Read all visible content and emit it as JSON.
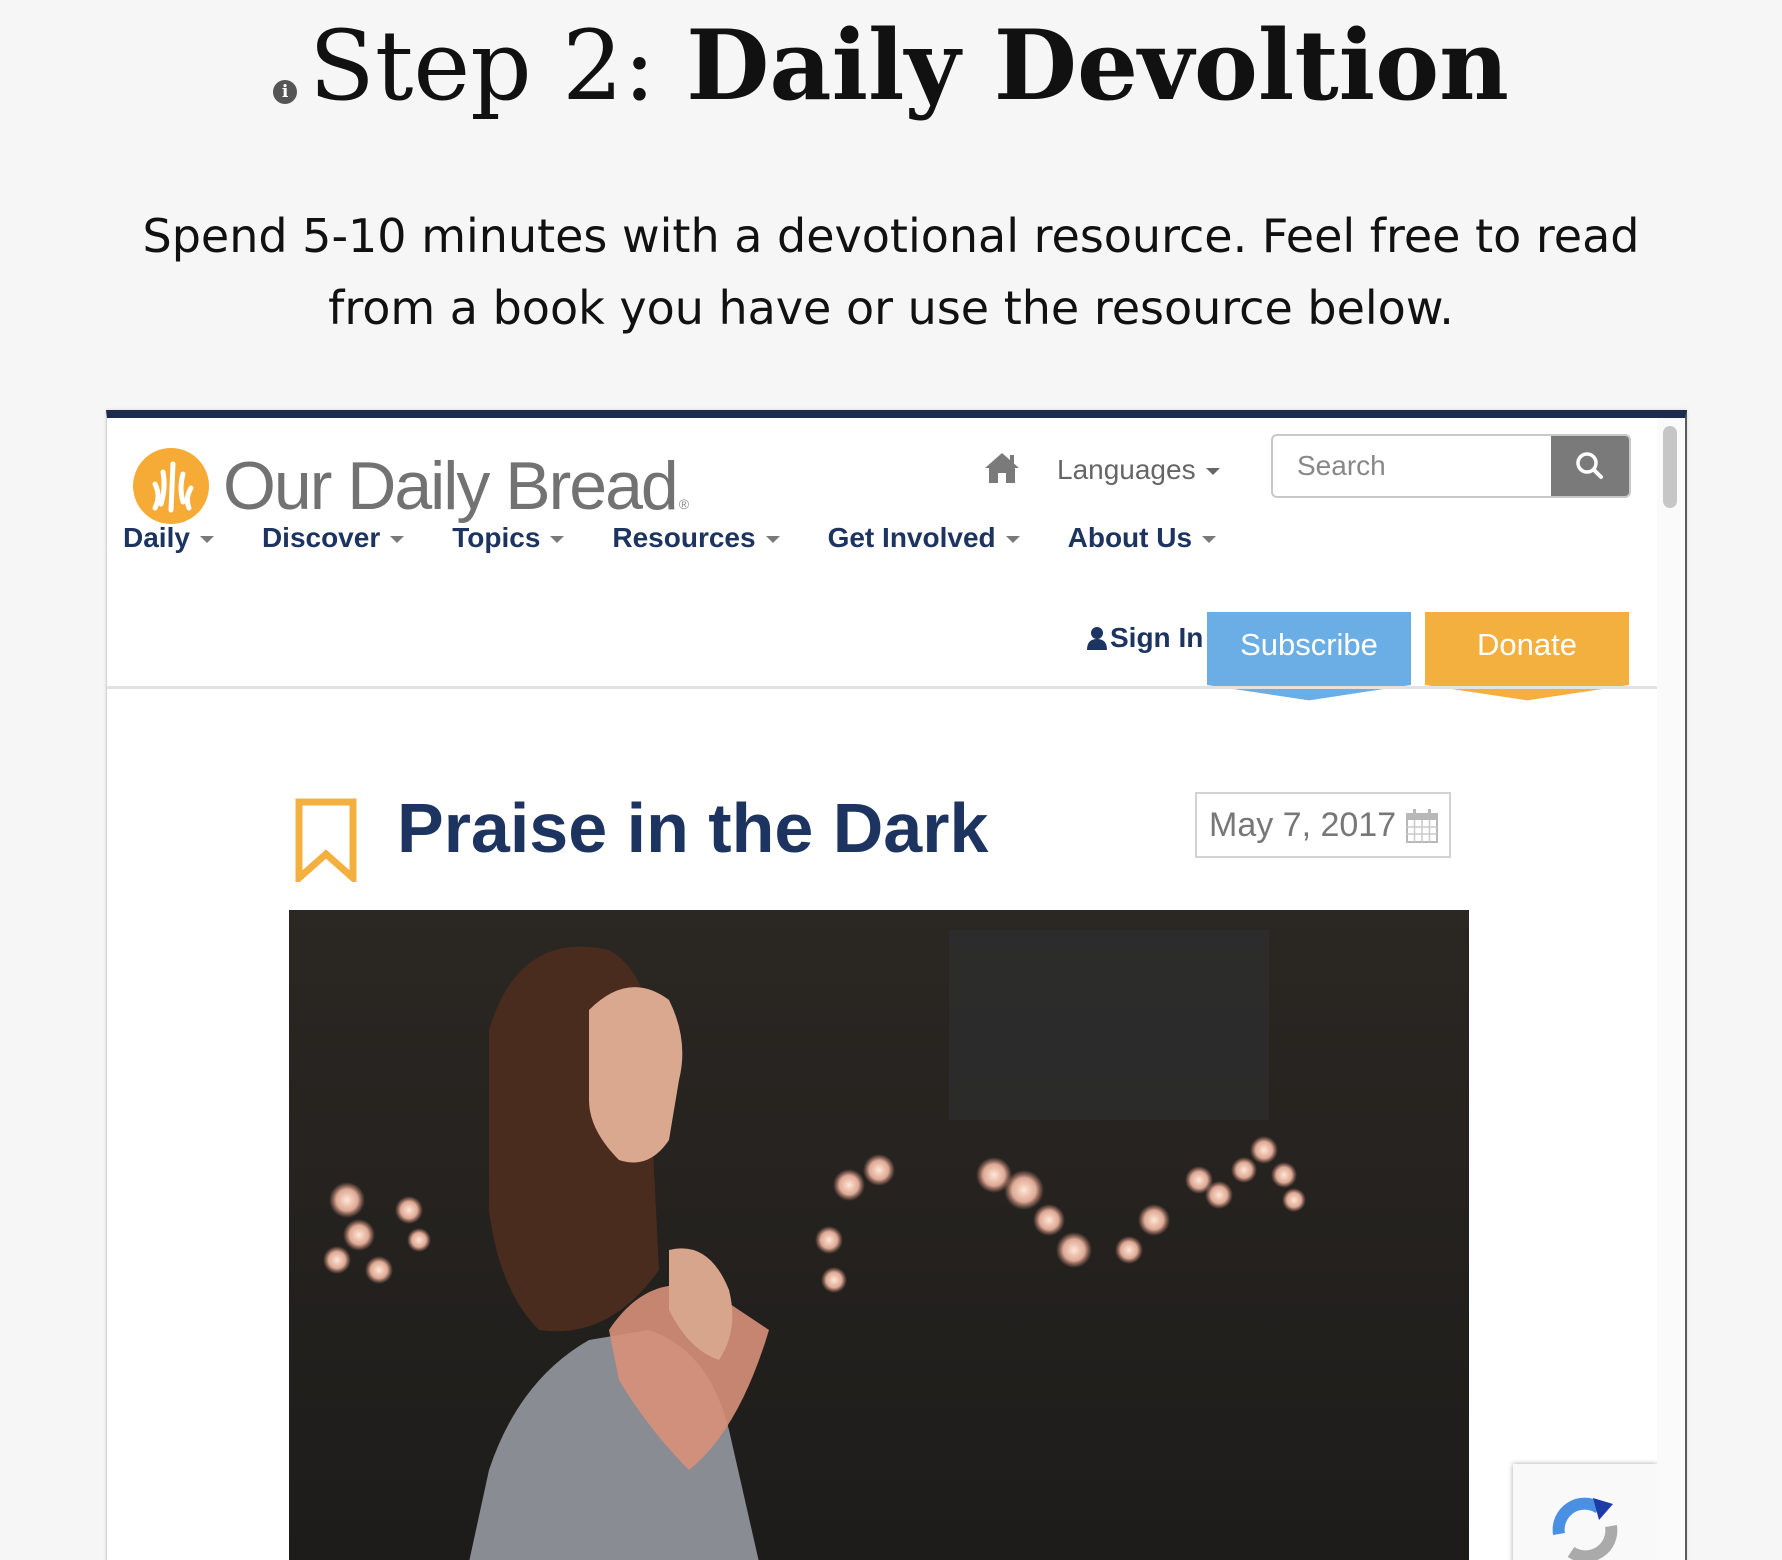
{
  "step": {
    "prefix": "Step 2: ",
    "title": "Daily Devoltion",
    "info_icon": "info-icon",
    "description": "Spend 5-10 minutes with a devotional resource. Feel free to read from a book you have or use the resource below."
  },
  "site": {
    "logo_text": "Our Daily Bread",
    "logo_registered": "®",
    "languages_label": "Languages",
    "search": {
      "placeholder": "Search",
      "value": ""
    },
    "nav": [
      {
        "label": "Daily"
      },
      {
        "label": "Discover"
      },
      {
        "label": "Topics"
      },
      {
        "label": "Resources"
      },
      {
        "label": "Get Involved"
      },
      {
        "label": "About Us"
      }
    ],
    "sign_in_label": "Sign In",
    "subscribe_label": "Subscribe",
    "donate_label": "Donate",
    "colors": {
      "navy": "#1d3461",
      "logo_orange": "#f5ab35",
      "subscribe_blue": "#6aaee5",
      "donate_orange": "#f4b03f"
    },
    "icons": [
      "home-icon",
      "search-icon",
      "person-icon",
      "bookmark-icon",
      "calendar-icon",
      "recaptcha-icon"
    ]
  },
  "article": {
    "title": "Praise in the Dark",
    "date": "May 7, 2017",
    "image": "woman praying with eyes closed, bokeh lights in dark room"
  }
}
